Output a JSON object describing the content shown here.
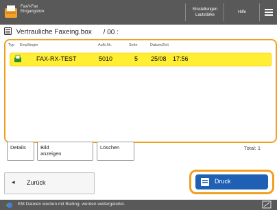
{
  "header": {
    "title_line1": "Fax/I-Fax",
    "title_line2": "Eingangsbox",
    "settings_line1": "Einstellungen",
    "settings_line2": "Lautstärke",
    "help_label": "Hilfe",
    "menu_icon": "hamburger-menu-icon"
  },
  "box": {
    "title": "Vertrauliche Faxeing.box",
    "number": "/ 00 :"
  },
  "columns": {
    "type": "Typ",
    "recipient": "Empfänger",
    "job_no": "Auftr.Nr.",
    "page": "Seite",
    "datetime": "Datum/Zeit"
  },
  "rows": [
    {
      "icon": "fax-doc-icon",
      "recipient": "FAX-RX-TEST",
      "job_no": "5010",
      "pages": "5",
      "date": "25/08",
      "time": "17:56"
    }
  ],
  "actions": {
    "details": "Details",
    "view_line1": "Bild",
    "view_line2": "anzeigen",
    "delete": "Löschen",
    "total": "Total: 1"
  },
  "nav": {
    "back_label": "Zurück",
    "back_icon": "left-arrow-icon",
    "print_label": "Druck",
    "print_icon": "print-icon"
  },
  "status": {
    "message": "EM Dateien werden mit Beding. werden weitergeleitet.",
    "left_icon": "network-status-icon",
    "right_icon": "window-icon"
  },
  "colors": {
    "accent_orange": "#f0a020",
    "selected_yellow": "#ffee33",
    "print_blue": "#1f5fb4",
    "bar_gray": "#595959"
  }
}
